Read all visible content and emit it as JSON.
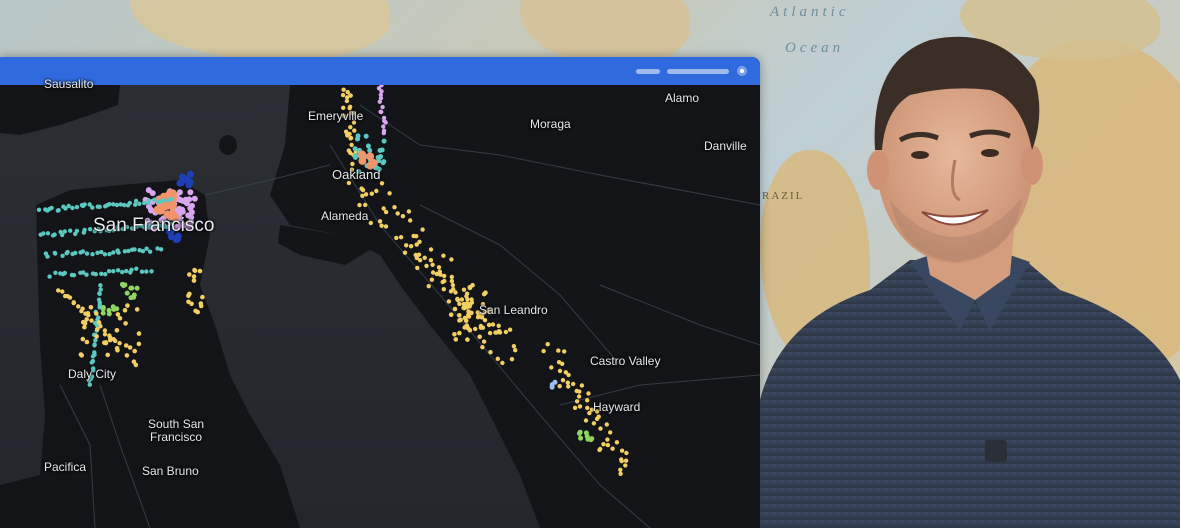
{
  "background": {
    "ocean_labels": [
      "Atlantic",
      "Ocean"
    ],
    "country_label": "RAZIL"
  },
  "map": {
    "places": {
      "sausalito": "Sausalito",
      "emeryville": "Emeryville",
      "alamo": "Alamo",
      "moraga": "Moraga",
      "danville": "Danville",
      "oakland": "Oakland",
      "san_francisco": "San Francisco",
      "alameda": "Alameda",
      "san_leandro": "San Leandro",
      "castro_valley": "Castro Valley",
      "daly_city": "Daly City",
      "hayward": "Hayward",
      "south_san_francisco_1": "South San",
      "south_san_francisco_2": "Francisco",
      "pacifica": "Pacifica",
      "san_bruno": "San Bruno"
    },
    "dot_colors": {
      "yellow": "#f3cf63",
      "cyan": "#5cc8c2",
      "pink": "#d8a6ee",
      "orange": "#f2956a",
      "blue": "#1f3fb8",
      "green": "#8fd55f",
      "light-blue": "#9cc0f0"
    }
  },
  "colors": {
    "titlebar": "#2f6bde",
    "map_water": "#2a2e33",
    "map_land": "#121418"
  }
}
